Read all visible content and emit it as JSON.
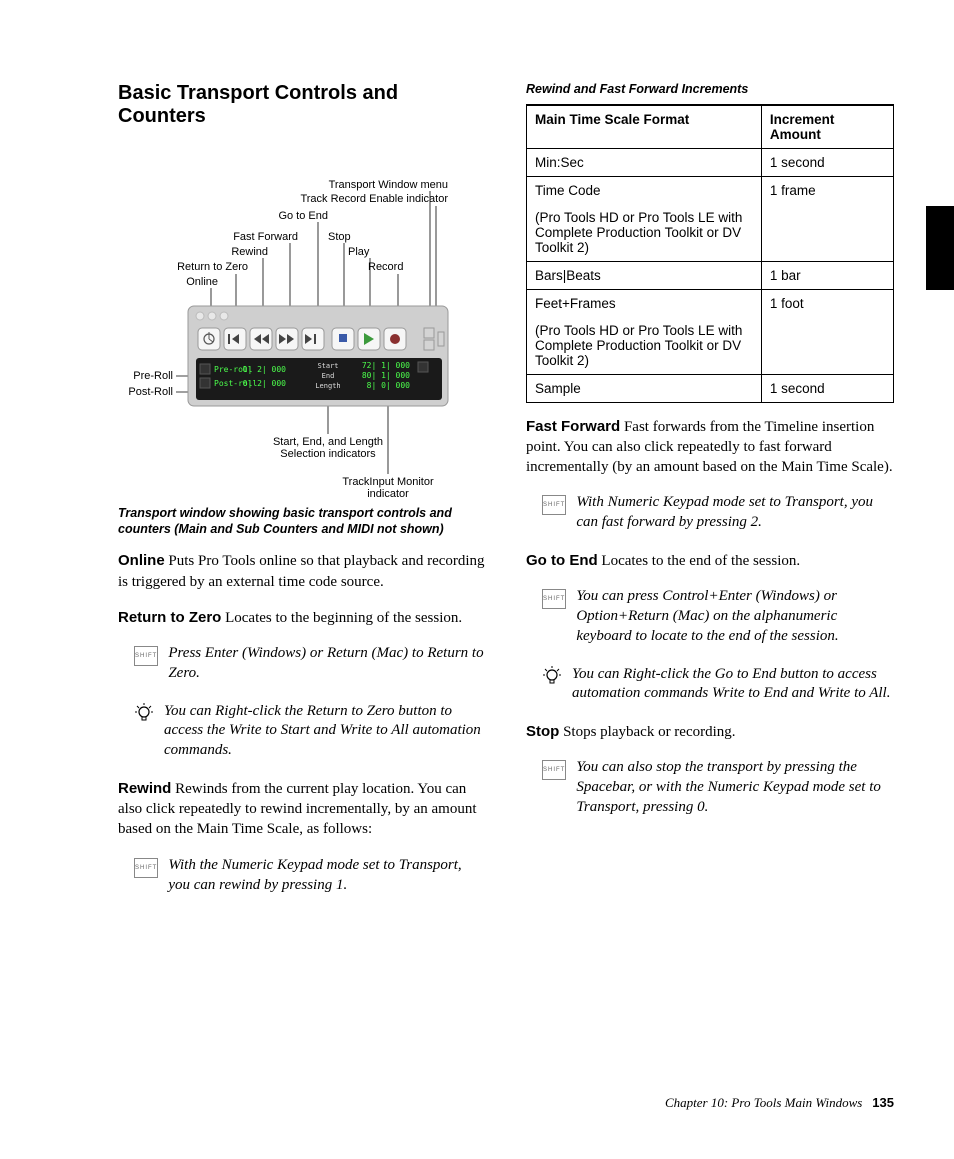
{
  "title": "Basic Transport Controls and Counters",
  "figure": {
    "labels": {
      "online": "Online",
      "return_to_zero": "Return to Zero",
      "rewind": "Rewind",
      "fast_forward": "Fast Forward",
      "go_to_end": "Go to End",
      "stop": "Stop",
      "play": "Play",
      "record": "Record",
      "menu": "Transport Window menu",
      "rec_enable": "Track Record Enable indicator",
      "pre_roll": "Pre-Roll",
      "post_roll": "Post-Roll",
      "selection": "Start, End, and Length\nSelection indicators",
      "track_input": "TrackInput Monitor\nindicator"
    },
    "panel": {
      "pre_roll_label": "Pre-roll",
      "post_roll_label": "Post-roll",
      "pre_roll_val": "0| 2| 000",
      "post_roll_val": "0| 2| 000",
      "start_label": "Start",
      "end_label": "End",
      "length_label": "Length",
      "start_val": "72| 1| 000",
      "end_val": "80| 1| 000",
      "length_val": "8| 0| 000"
    },
    "caption": "Transport window showing basic transport controls and counters (Main and Sub Counters and MIDI not shown)"
  },
  "left_body": {
    "online": {
      "label": "Online",
      "text": " Puts Pro Tools online so that playback and recording is triggered by an external time code source."
    },
    "return_to_zero": {
      "label": "Return to Zero",
      "text": " Locates to the beginning of the session."
    },
    "note_return_zero": "Press Enter (Windows) or Return (Mac) to Return to Zero.",
    "tip_return_zero": "You can Right-click the Return to Zero button to access the Write to Start and Write to All automation commands.",
    "rewind": {
      "label": "Rewind",
      "text": " Rewinds from the current play location. You can also click repeatedly to rewind incrementally, by an amount based on the Main Time Scale, as follows:"
    },
    "note_rewind": "With the Numeric Keypad mode set to Transport, you can rewind by pressing 1."
  },
  "table": {
    "title": "Rewind and Fast Forward Increments",
    "headers": [
      "Main Time Scale Format",
      "Increment Amount"
    ],
    "rows": [
      {
        "format": "Min:Sec",
        "sub": "",
        "inc": "1 second"
      },
      {
        "format": "Time Code",
        "sub": "(Pro Tools HD or Pro Tools LE with Complete Production Toolkit or DV Toolkit 2)",
        "inc": "1 frame"
      },
      {
        "format": "Bars|Beats",
        "sub": "",
        "inc": "1 bar"
      },
      {
        "format": "Feet+Frames",
        "sub": "(Pro Tools HD or Pro Tools LE with Complete Production Toolkit or DV Toolkit 2)",
        "inc": "1 foot"
      },
      {
        "format": "Sample",
        "sub": "",
        "inc": "1 second"
      }
    ]
  },
  "right_body": {
    "fast_forward": {
      "label": "Fast Forward",
      "text": " Fast forwards from the Timeline insertion point. You can also click repeatedly to fast forward incrementally (by an amount based on the Main Time Scale)."
    },
    "note_ff": "With Numeric Keypad mode set to Transport, you can fast forward by pressing 2.",
    "go_to_end": {
      "label": "Go to End",
      "text": " Locates to the end of the session."
    },
    "note_end": "You can press Control+Enter (Windows) or Option+Return (Mac) on the alphanumeric keyboard to locate to the end of the session.",
    "tip_end": "You can Right-click the Go to End button to access automation commands Write to End and Write to All.",
    "stop": {
      "label": "Stop",
      "text": " Stops playback or recording."
    },
    "note_stop": "You can also stop the transport by pressing the Spacebar, or with the Numeric Keypad mode set to Transport, pressing 0."
  },
  "footer": {
    "chapter": "Chapter 10: Pro Tools Main Windows",
    "page": "135"
  }
}
